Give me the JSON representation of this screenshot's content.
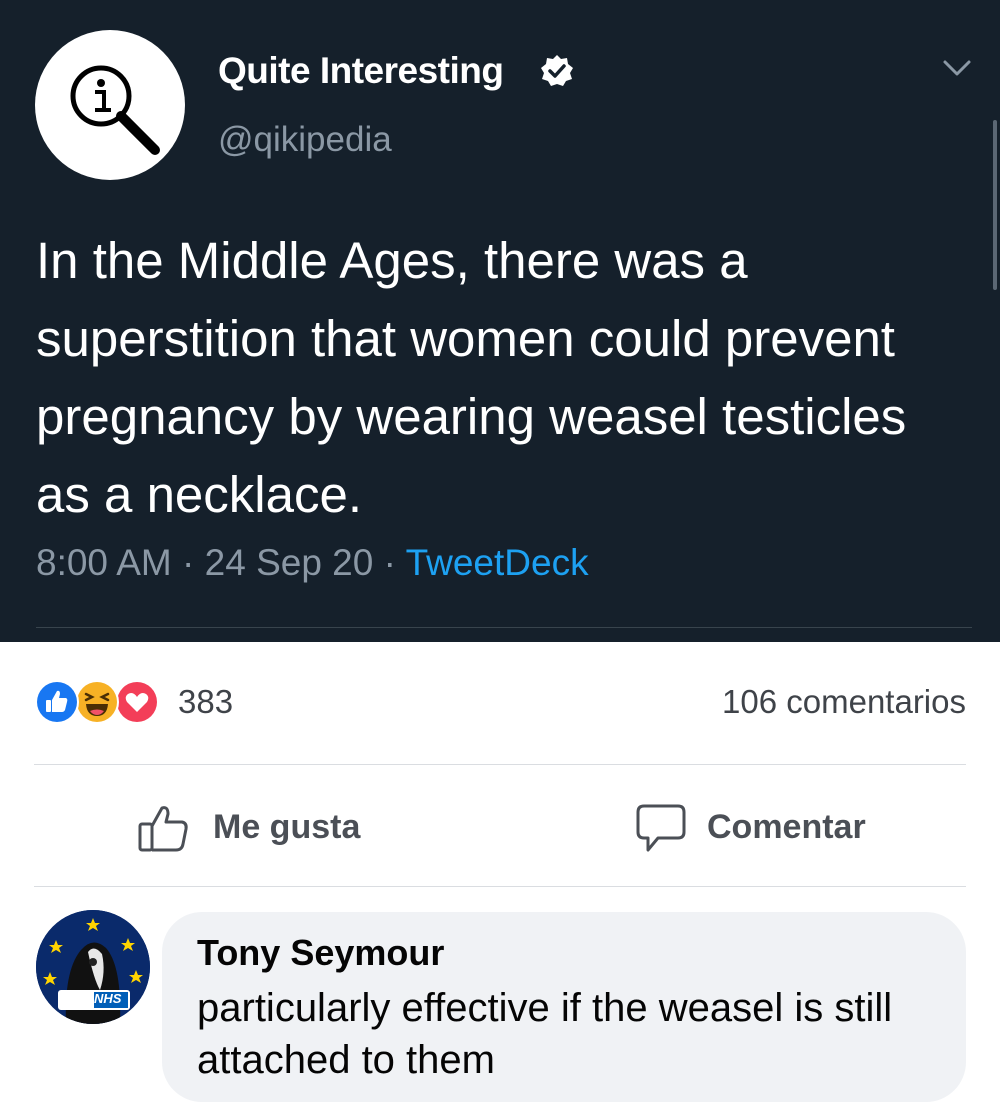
{
  "tweet": {
    "name": "Quite Interesting",
    "handle": "@qikipedia",
    "text": "In the Middle Ages, there was a superstition that women could prevent pregnancy by wearing weasel testicles as a necklace.",
    "time_date": "8:00 AM · 24 Sep 20 · ",
    "source": "TweetDeck"
  },
  "post": {
    "reaction_count": "383",
    "comment_count": "106 comentarios",
    "like_label": "Me gusta",
    "comment_label": "Comentar",
    "reactions": [
      "like-icon",
      "haha-icon",
      "love-icon"
    ]
  },
  "comment": {
    "author": "Tony Seymour",
    "text": "particularly effective if the weasel is still attached to them",
    "avatar_badge": "NHS"
  },
  "colors": {
    "tweet_bg": "#15202b",
    "link_blue": "#1da1f2",
    "like_blue": "#1877f2",
    "love_red": "#f33e58",
    "haha_yellow": "#f7b125"
  }
}
